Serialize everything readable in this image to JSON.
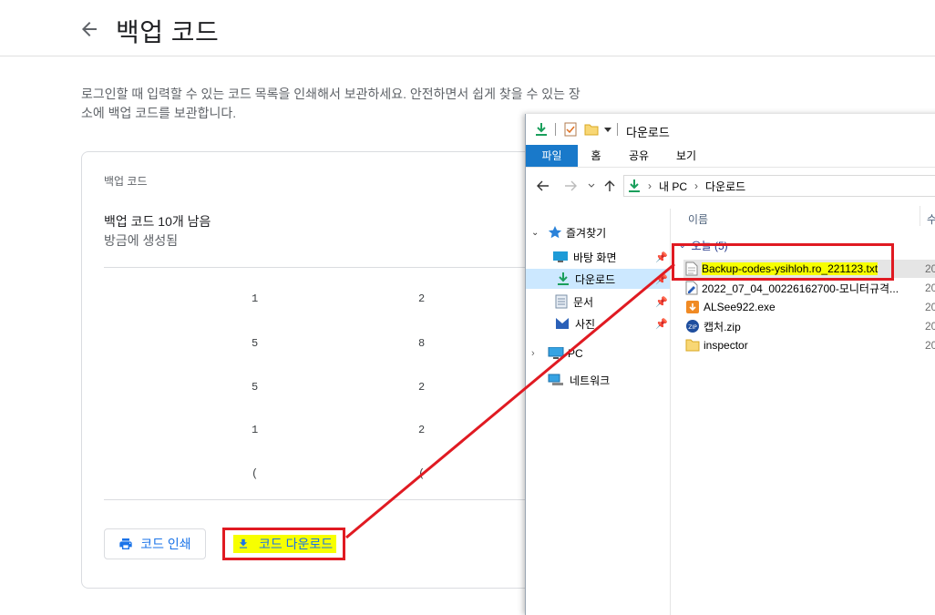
{
  "page": {
    "title": "백업 코드",
    "description": "로그인할 때 입력할 수 있는 코드 목록을 인쇄해서 보관하세요. 안전하면서 쉽게 찾을 수 있는 장소에 백업 코드를 보관합니다."
  },
  "card": {
    "label": "백업 코드",
    "remaining": "백업 코드 10개 남음",
    "generated": "방금에 생성됨",
    "code_fragments": [
      [
        "1",
        "2"
      ],
      [
        "5",
        "8"
      ],
      [
        "5",
        "2"
      ],
      [
        "1",
        "2"
      ],
      [
        "(",
        "("
      ]
    ],
    "print_label": "코드 인쇄",
    "download_label": "코드 다운로드"
  },
  "explorer": {
    "title": "다운로드",
    "tabs": [
      "파일",
      "홈",
      "공유",
      "보기"
    ],
    "breadcrumb": [
      "내 PC",
      "다운로드"
    ],
    "nav": {
      "quick_access": "즐겨찾기",
      "items": [
        "바탕 화면",
        "다운로드",
        "문서",
        "사진"
      ],
      "this_pc": "PC",
      "network": "네트워크"
    },
    "columns": {
      "name": "이름",
      "next": "수"
    },
    "group_label": "오늘 (5)",
    "files": [
      {
        "name": "Backup-codes-ysihloh.ro_221123.txt",
        "date": "20",
        "icon": "text-file-icon"
      },
      {
        "name": "2022_07_04_00226162700-모니터규격...",
        "date": "20",
        "icon": "edit-file-icon"
      },
      {
        "name": "ALSee922.exe",
        "date": "20",
        "icon": "installer-icon"
      },
      {
        "name": "캡처.zip",
        "date": "20",
        "icon": "zip-icon"
      },
      {
        "name": "inspector",
        "date": "20",
        "icon": "folder-icon"
      }
    ]
  },
  "colors": {
    "accent": "#1a73e8",
    "highlight": "#f7ff00",
    "annotation": "#e01a22",
    "ribbon_file": "#1979ca"
  }
}
